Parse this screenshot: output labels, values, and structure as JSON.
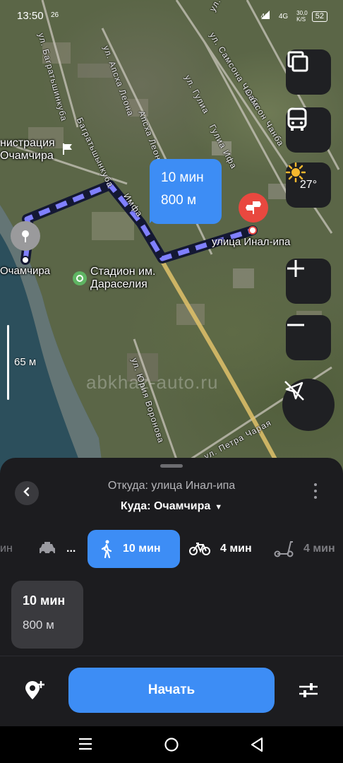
{
  "status_bar": {
    "time": "13:50",
    "extra": "26",
    "network": "4G",
    "network2": "4G",
    "speed": "30,0\nK/S",
    "battery": "52"
  },
  "map": {
    "streets": [
      "ул. Гор",
      "ул. Самсона Чанба",
      "Самсон Чанба",
      "ул. Апсха Леона",
      "Апсха Леона",
      "ул. Гулиа",
      "Гулиа Ифа",
      "ул. Багратьшинкуба",
      "Багратьшынкуба",
      "Имфа",
      "ул. Юрия Воронова",
      "ул. Петра Чарая"
    ],
    "labels": {
      "admin_line1": "нистрация",
      "admin_line2": "Очамчира",
      "ochamchira": "Очамчира",
      "stadium_line1": "Стадион им.",
      "stadium_line2": "Дараселия",
      "destination": "улица Инал-ипа"
    },
    "route_bubble": {
      "time": "10 мин",
      "distance": "800 м"
    },
    "scale_label": "65 м",
    "watermark": "abkhaz-auto.ru",
    "weather_temp": "27°"
  },
  "sheet": {
    "from": "Откуда: улица Инал-ипа",
    "to": "Куда: Очамчира",
    "to_arrow": "▼",
    "modes": [
      {
        "name": "transit",
        "label": "ин",
        "icon": "transit-icon"
      },
      {
        "name": "taxi",
        "label": "...",
        "icon": "taxi-icon"
      },
      {
        "name": "walk",
        "label": "10 мин",
        "icon": "pedestrian-icon",
        "active": true
      },
      {
        "name": "bike",
        "label": "4 мин",
        "icon": "bicycle-icon"
      },
      {
        "name": "scooter",
        "label": "4 мин",
        "icon": "scooter-icon"
      }
    ],
    "card": {
      "time": "10 мин",
      "distance": "800 м"
    },
    "start_label": "Начать"
  },
  "colors": {
    "accent": "#3d8df5",
    "sheet_bg": "#1c1c1f",
    "route": "#8080ff",
    "destination_pin": "#e9483f"
  }
}
